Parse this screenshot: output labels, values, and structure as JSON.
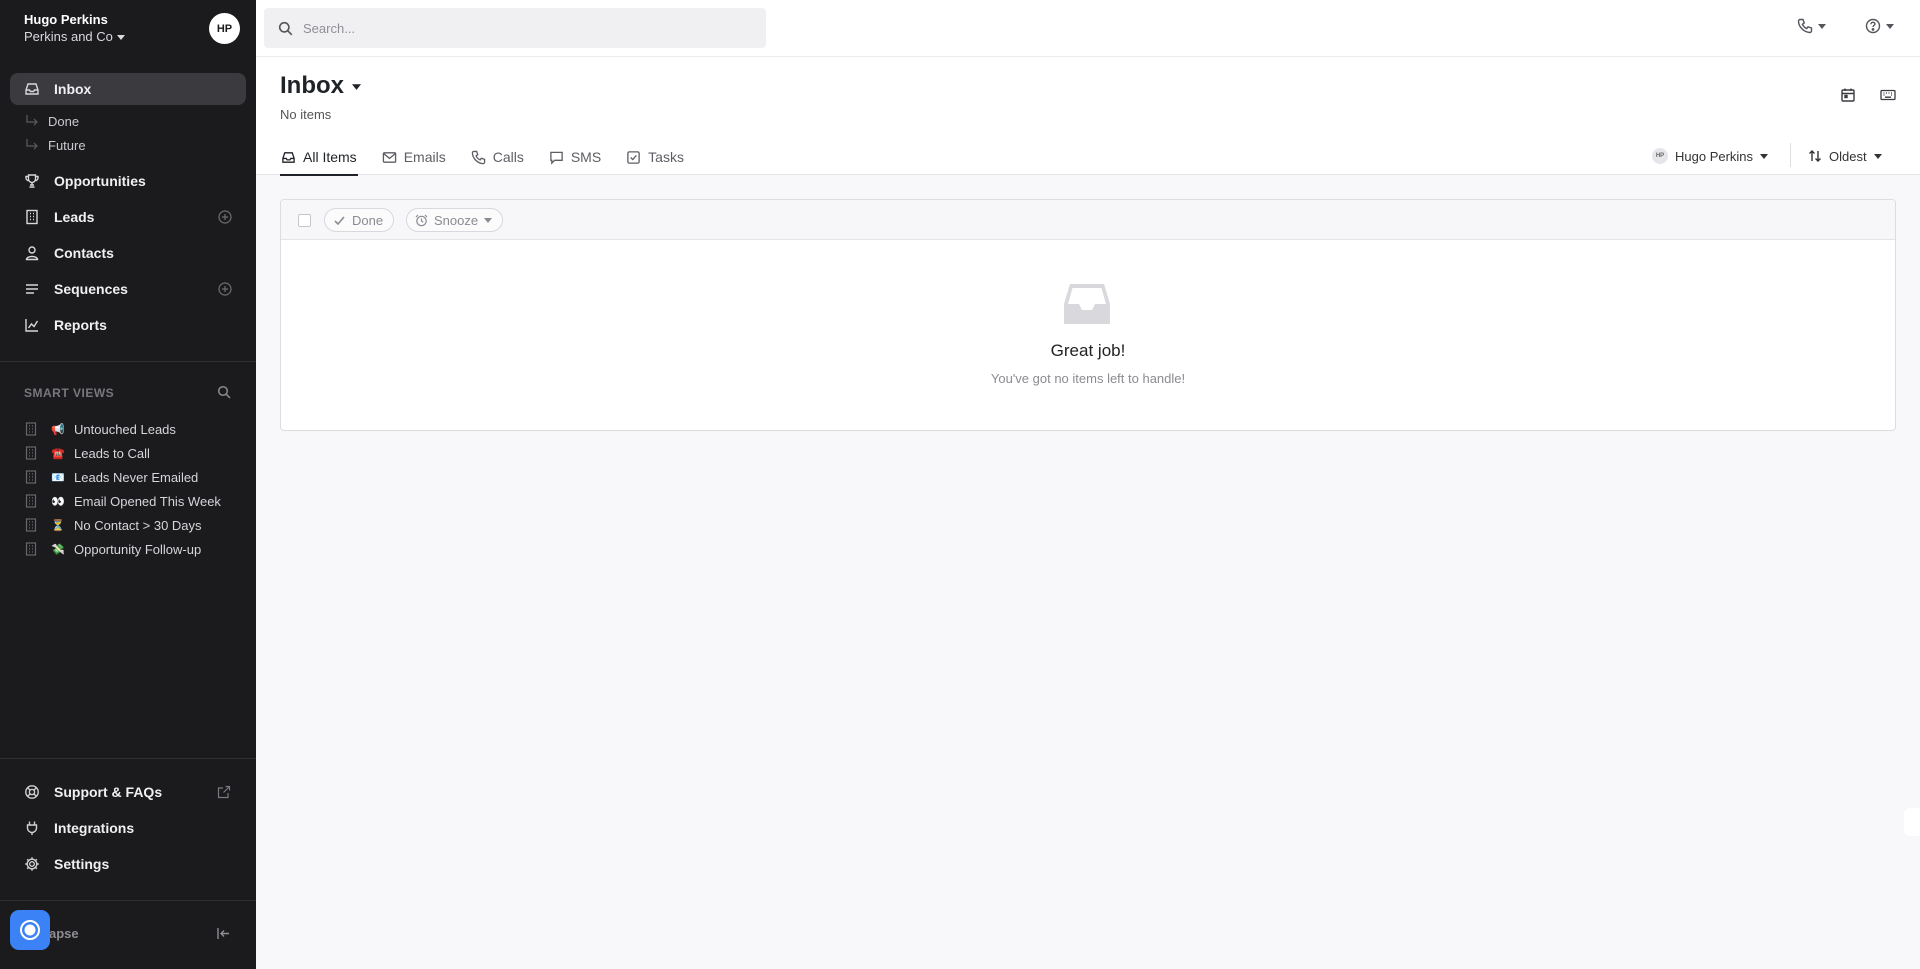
{
  "sidebar": {
    "user_name": "Hugo Perkins",
    "org_name": "Perkins and Co",
    "avatar_initials": "HP",
    "nav": [
      {
        "label": "Inbox",
        "icon": "inbox-icon"
      },
      {
        "label": "Opportunities",
        "icon": "trophy-icon"
      },
      {
        "label": "Leads",
        "icon": "building-icon"
      },
      {
        "label": "Contacts",
        "icon": "user-icon"
      },
      {
        "label": "Sequences",
        "icon": "list-icon"
      },
      {
        "label": "Reports",
        "icon": "chart-icon"
      }
    ],
    "inbox_sub": [
      "Done",
      "Future"
    ],
    "smart_views_title": "SMART VIEWS",
    "smart_views": [
      {
        "label": "Untouched Leads",
        "emoji": "📢"
      },
      {
        "label": "Leads to Call",
        "emoji": "☎️"
      },
      {
        "label": "Leads Never Emailed",
        "emoji": "📧"
      },
      {
        "label": "Email Opened This Week",
        "emoji": "👀"
      },
      {
        "label": "No Contact > 30 Days",
        "emoji": "⏳"
      },
      {
        "label": "Opportunity Follow-up",
        "emoji": "💸"
      }
    ],
    "bottom": [
      {
        "label": "Support & FAQs",
        "icon": "lifebuoy-icon"
      },
      {
        "label": "Integrations",
        "icon": "plug-icon"
      },
      {
        "label": "Settings",
        "icon": "gear-icon"
      }
    ],
    "collapse_label": "apse"
  },
  "topbar": {
    "search_placeholder": "Search..."
  },
  "header": {
    "title": "Inbox",
    "subtitle": "No items",
    "tabs": [
      {
        "label": "All Items",
        "icon": "inbox-icon"
      },
      {
        "label": "Emails",
        "icon": "mail-icon"
      },
      {
        "label": "Calls",
        "icon": "phone-icon"
      },
      {
        "label": "SMS",
        "icon": "message-icon"
      },
      {
        "label": "Tasks",
        "icon": "checkbox-icon"
      }
    ],
    "active_tab": "All Items",
    "filter_user_initials": "HP",
    "filter_user": "Hugo Perkins",
    "sort_label": "Oldest"
  },
  "toolbar": {
    "done_label": "Done",
    "snooze_label": "Snooze"
  },
  "empty_state": {
    "title": "Great job!",
    "message": "You've got no items left to handle!"
  },
  "colors": {
    "sidebar_bg": "#1b1b1e",
    "sidebar_active": "#3a3a3f",
    "content_bg": "#f8f8fb",
    "widget_blue": "#3b82f6"
  }
}
